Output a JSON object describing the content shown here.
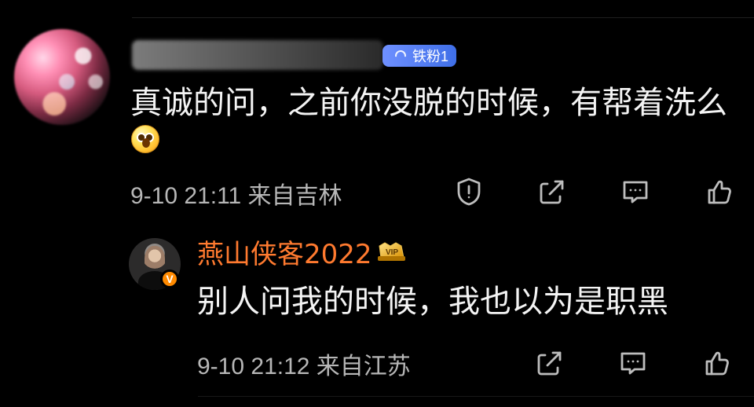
{
  "comment": {
    "badge": "铁粉1",
    "text_line1": "真诚的问，之前你没脱的时候，有帮着洗么",
    "emoji": "astonished-face-emoji",
    "meta": "9-10 21:11  来自吉林",
    "actions": [
      "report-icon",
      "share-icon",
      "comment-icon",
      "like-icon"
    ]
  },
  "reply": {
    "username": "燕山侠客2022",
    "vip_label": "VIP",
    "text": "别人问我的时候，我也以为是职黑",
    "meta": "9-10 21:12  来自江苏",
    "verified_label": "V",
    "actions": [
      "share-icon",
      "comment-icon",
      "like-icon"
    ]
  },
  "colors": {
    "background": "#000000",
    "text": "#f4f4f4",
    "meta": "#b7b7b7",
    "username": "#ff7a2f",
    "badge": "#4f76ec"
  }
}
